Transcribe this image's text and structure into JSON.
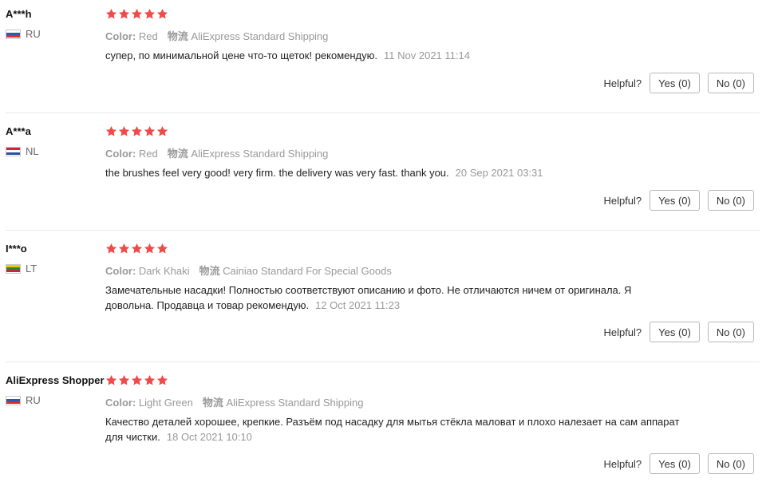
{
  "colors": {
    "star": "#e62e04",
    "meta_text": "#999999",
    "divider": "#e8e8e8"
  },
  "helpful_label": "Helpful?",
  "reviews": [
    {
      "user": "A***h",
      "country": "RU",
      "flag": "russia-flag-icon",
      "rating": 5,
      "option_label": "Color:",
      "option_value": "Red",
      "shipping_label": "物流",
      "shipping_value": "AliExpress Standard Shipping",
      "text": "супер, по минимальной цене что-то щеток! рекомендую.",
      "date": "11 Nov 2021 11:14",
      "yes": "Yes (0)",
      "no": "No (0)"
    },
    {
      "user": "A***a",
      "country": "NL",
      "flag": "netherlands-flag-icon",
      "rating": 5,
      "option_label": "Color:",
      "option_value": "Red",
      "shipping_label": "物流",
      "shipping_value": "AliExpress Standard Shipping",
      "text": "the brushes feel very good! very firm. the delivery was very fast. thank you.",
      "date": "20 Sep 2021 03:31",
      "yes": "Yes (0)",
      "no": "No (0)"
    },
    {
      "user": "I***o",
      "country": "LT",
      "flag": "lithuania-flag-icon",
      "rating": 5,
      "option_label": "Color:",
      "option_value": "Dark Khaki",
      "shipping_label": "物流",
      "shipping_value": "Cainiao Standard For Special Goods",
      "text": "Замечательные насадки! Полностью соответствуют описанию и фото. Не отличаются ничем от оригинала. Я довольна. Продавца и товар рекомендую.",
      "date": "12 Oct 2021 11:23",
      "yes": "Yes (0)",
      "no": "No (0)"
    },
    {
      "user": "AliExpress Shopper",
      "country": "RU",
      "flag": "russia-flag-icon",
      "rating": 5,
      "option_label": "Color:",
      "option_value": "Light Green",
      "shipping_label": "物流",
      "shipping_value": "AliExpress Standard Shipping",
      "text": "Качество деталей хорошее, крепкие. Разъём под насадку для мытья стёкла маловат и плохо налезает на сам аппарат для чистки.",
      "date": "18 Oct 2021 10:10",
      "yes": "Yes (0)",
      "no": "No (0)"
    }
  ]
}
